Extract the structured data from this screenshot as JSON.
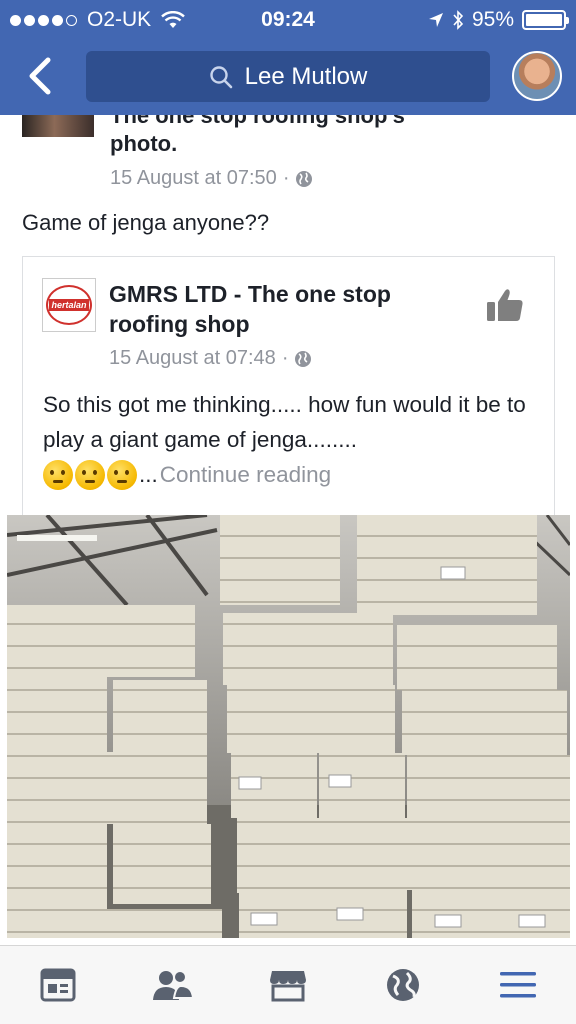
{
  "status_bar": {
    "carrier": "O2-UK",
    "time": "09:24",
    "battery": "95%",
    "battery_level": 0.95
  },
  "header": {
    "search_text": "Lee Mutlow",
    "back_icon": "chevron-left-icon",
    "search_icon": "search-icon",
    "profile_icon": "avatar"
  },
  "post": {
    "title_partial": "The one stop roofing shop's",
    "title_line2": "photo.",
    "date": "15 August at 07:50",
    "separator": "·",
    "text": "Game of jenga anyone??"
  },
  "shared_post": {
    "logo_text": "hertalan",
    "title": "GMRS LTD - The one stop roofing shop",
    "date": "15 August at 07:48",
    "separator": "·",
    "body": "So this got me thinking..... how fun would it be to play a giant game of jenga........",
    "ellipsis": "...",
    "continue_label": "Continue reading"
  },
  "colors": {
    "header_blue": "#4267b2",
    "search_bg": "#2f4f8f",
    "meta_gray": "#90949c",
    "active_tab": "#4267b2",
    "inactive_tab": "#5a6270"
  },
  "tab_bar": [
    {
      "name": "news-feed-icon",
      "active": false
    },
    {
      "name": "friends-icon",
      "active": false
    },
    {
      "name": "marketplace-icon",
      "active": false
    },
    {
      "name": "notifications-globe-icon",
      "active": false
    },
    {
      "name": "menu-icon",
      "active": true
    }
  ]
}
